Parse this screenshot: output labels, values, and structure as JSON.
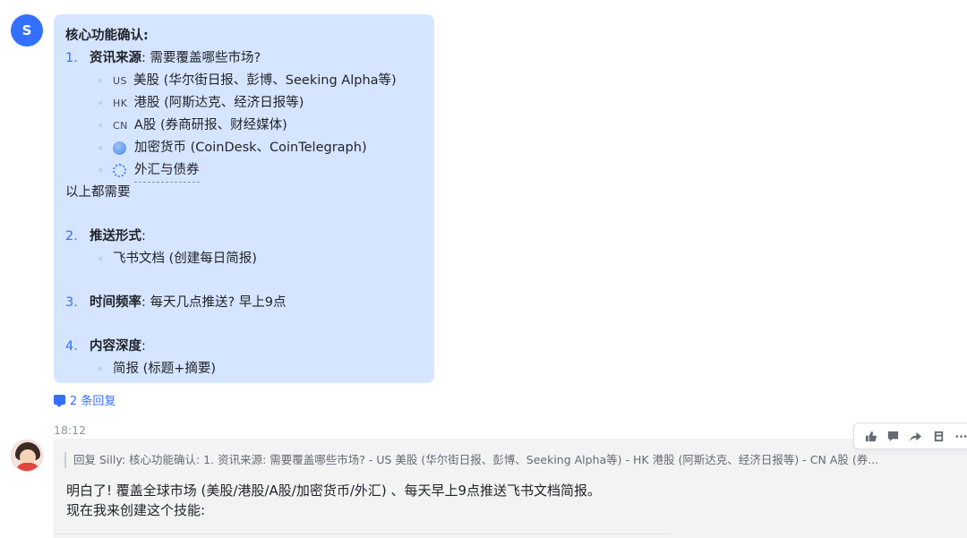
{
  "user_avatar": {
    "initial": "S",
    "color": "#3370ff"
  },
  "message": {
    "title": "核心功能确认:",
    "sections": [
      {
        "num": "1.",
        "label": "资讯来源",
        "text": ": 需要覆盖哪些市场?",
        "items": [
          {
            "flag": "US",
            "text": "美股 (华尔街日报、彭博、Seeking Alpha等)"
          },
          {
            "flag": "HK",
            "text": "港股 (阿斯达克、经济日报等)"
          },
          {
            "flag": "CN",
            "text": "A股 (券商研报、财经媒体)"
          },
          {
            "icon": "globe-icon",
            "text": "加密货币 (CoinDesk、CoinTelegraph)"
          },
          {
            "icon": "cycle-icon",
            "text": "外汇与债券"
          }
        ],
        "after": "以上都需要"
      },
      {
        "num": "2.",
        "label": "推送形式",
        "text": ":",
        "items": [
          {
            "text": "飞书文档 (创建每日简报)"
          }
        ]
      },
      {
        "num": "3.",
        "label": "时间频率",
        "text": ": 每天几点推送? 早上9点"
      },
      {
        "num": "4.",
        "label": "内容深度",
        "text": ":",
        "items": [
          {
            "text": "简报 (标题+摘要)"
          }
        ]
      }
    ]
  },
  "replies_link": "2 条回复",
  "timestamp": "18:12",
  "reply": {
    "quote": "回复 Silly: 核心功能确认: 1. 资讯来源: 需要覆盖哪些市场? - US 美股 (华尔街日报、彭博、Seeking Alpha等) - HK 港股 (阿斯达克、经济日报等) - CN A股 (券...",
    "line1": "明白了! 覆盖全球市场 (美股/港股/A股/加密货币/外汇) 、每天早上9点推送飞书文档简报。",
    "line2": "现在我来创建这个技能:"
  },
  "toolbar": [
    "thumbs-up-icon",
    "comment-icon",
    "forward-icon",
    "save-icon",
    "more-icon"
  ],
  "colors": {
    "accent": "#3370ff",
    "bubble": "#d6e5ff",
    "panel": "#f3f3f4"
  }
}
